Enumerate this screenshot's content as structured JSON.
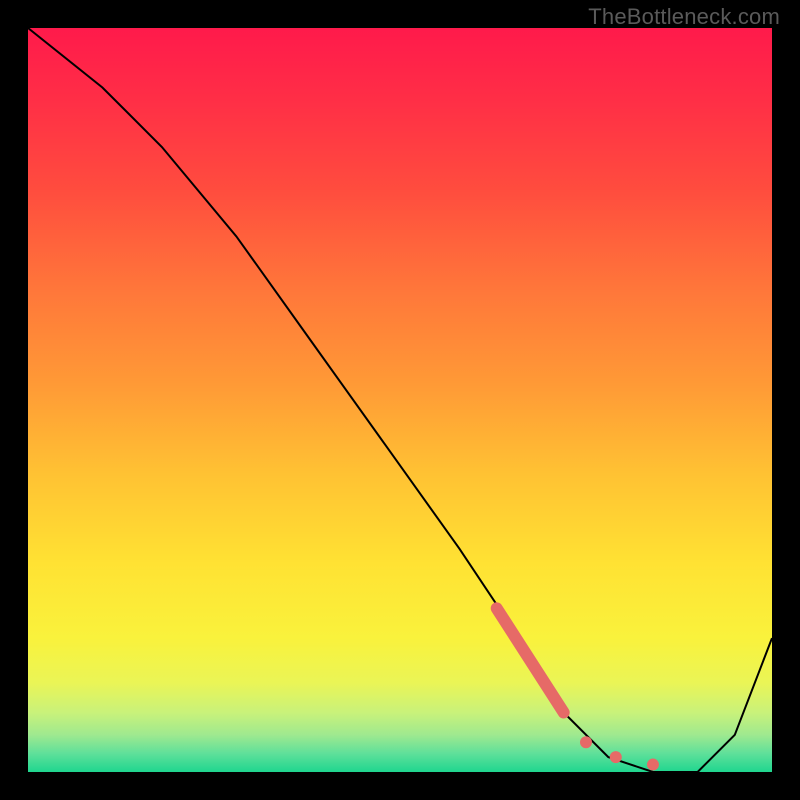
{
  "watermark": "TheBottleneck.com",
  "chart_data": {
    "type": "line",
    "title": "",
    "xlabel": "",
    "ylabel": "",
    "xlim": [
      0,
      100
    ],
    "ylim": [
      0,
      100
    ],
    "grid": false,
    "legend": false,
    "series": [
      {
        "name": "curve",
        "x": [
          0,
          10,
          18,
          28,
          38,
          48,
          58,
          66,
          72,
          78,
          84,
          90,
          95,
          100
        ],
        "y": [
          100,
          92,
          84,
          72,
          58,
          44,
          30,
          18,
          8,
          2,
          0,
          0,
          5,
          18
        ],
        "stroke": "#000000",
        "width": 2
      }
    ],
    "highlight": {
      "name": "highlight-segment",
      "color": "#e66a67",
      "x": [
        63,
        72
      ],
      "y": [
        22,
        8
      ],
      "width": 12
    },
    "dots": {
      "name": "highlight-dots",
      "color": "#e66a67",
      "r": 6,
      "points": [
        {
          "x": 75,
          "y": 4
        },
        {
          "x": 79,
          "y": 2
        },
        {
          "x": 84,
          "y": 1
        }
      ]
    },
    "background_gradient": {
      "stops": [
        {
          "offset": 0.0,
          "color": "#ff1a4b"
        },
        {
          "offset": 0.1,
          "color": "#ff2f46"
        },
        {
          "offset": 0.22,
          "color": "#ff4d3e"
        },
        {
          "offset": 0.35,
          "color": "#ff763a"
        },
        {
          "offset": 0.48,
          "color": "#ff9a36"
        },
        {
          "offset": 0.6,
          "color": "#ffc233"
        },
        {
          "offset": 0.72,
          "color": "#ffe233"
        },
        {
          "offset": 0.82,
          "color": "#f9f23c"
        },
        {
          "offset": 0.88,
          "color": "#eaf556"
        },
        {
          "offset": 0.92,
          "color": "#c9f27a"
        },
        {
          "offset": 0.95,
          "color": "#9fe98f"
        },
        {
          "offset": 0.975,
          "color": "#5fe09a"
        },
        {
          "offset": 1.0,
          "color": "#1fd68f"
        }
      ]
    }
  }
}
